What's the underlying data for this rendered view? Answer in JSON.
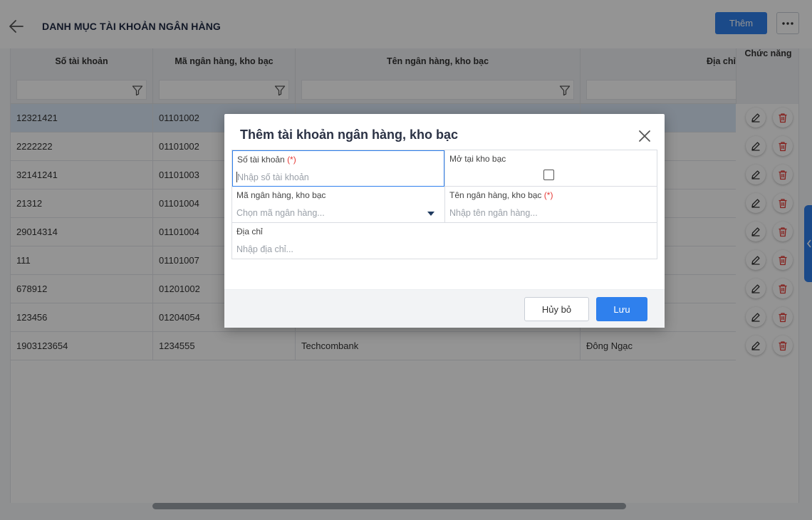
{
  "header": {
    "title": "DANH MỤC TÀI KHOẢN NGÂN HÀNG",
    "add_label": "Thêm"
  },
  "grid": {
    "columns": [
      "Số tài khoản",
      "Mã ngân hàng, kho bạc",
      "Tên ngân hàng, kho bạc",
      "Địa chỉ"
    ],
    "actions_header": "Chức năng",
    "rows": [
      {
        "account": "12321421",
        "code": "01101002",
        "name": "",
        "address": ""
      },
      {
        "account": "2222222",
        "code": "01101002",
        "name": "",
        "address": ""
      },
      {
        "account": "32141241",
        "code": "01101003",
        "name": "",
        "address": ""
      },
      {
        "account": "21312",
        "code": "01101004",
        "name": "",
        "address": ""
      },
      {
        "account": "29014314",
        "code": "01101004",
        "name": "",
        "address": ""
      },
      {
        "account": "111",
        "code": "01101007",
        "name": "",
        "address": ""
      },
      {
        "account": "678912",
        "code": "01201002",
        "name": "",
        "address": ""
      },
      {
        "account": "123456",
        "code": "01204054",
        "name": "",
        "address": ""
      },
      {
        "account": "1903123654",
        "code": "1234555",
        "name": "Techcombank",
        "address": "Đông Ngạc"
      }
    ],
    "selected_row": 0
  },
  "modal": {
    "title": "Thêm tài khoản ngân hàng, kho bạc",
    "required_mark": "(*)",
    "fields": {
      "account": {
        "label": "Số tài khoản",
        "placeholder": "Nhập số tài khoản"
      },
      "treasury": {
        "label": "Mở tại kho bạc",
        "checked": false
      },
      "bank_code": {
        "label": "Mã ngân hàng, kho bạc",
        "placeholder": "Chọn mã ngân hàng..."
      },
      "bank_name": {
        "label": "Tên ngân hàng, kho bạc",
        "placeholder": "Nhập tên ngân hàng..."
      },
      "address": {
        "label": "Địa chỉ",
        "placeholder": "Nhập địa chỉ..."
      }
    },
    "cancel_label": "Hủy bỏ",
    "save_label": "Lưu"
  },
  "colors": {
    "primary": "#2f80ed",
    "required": "#e53935",
    "delete": "#e53935",
    "selected_row": "#dbe8f8"
  }
}
